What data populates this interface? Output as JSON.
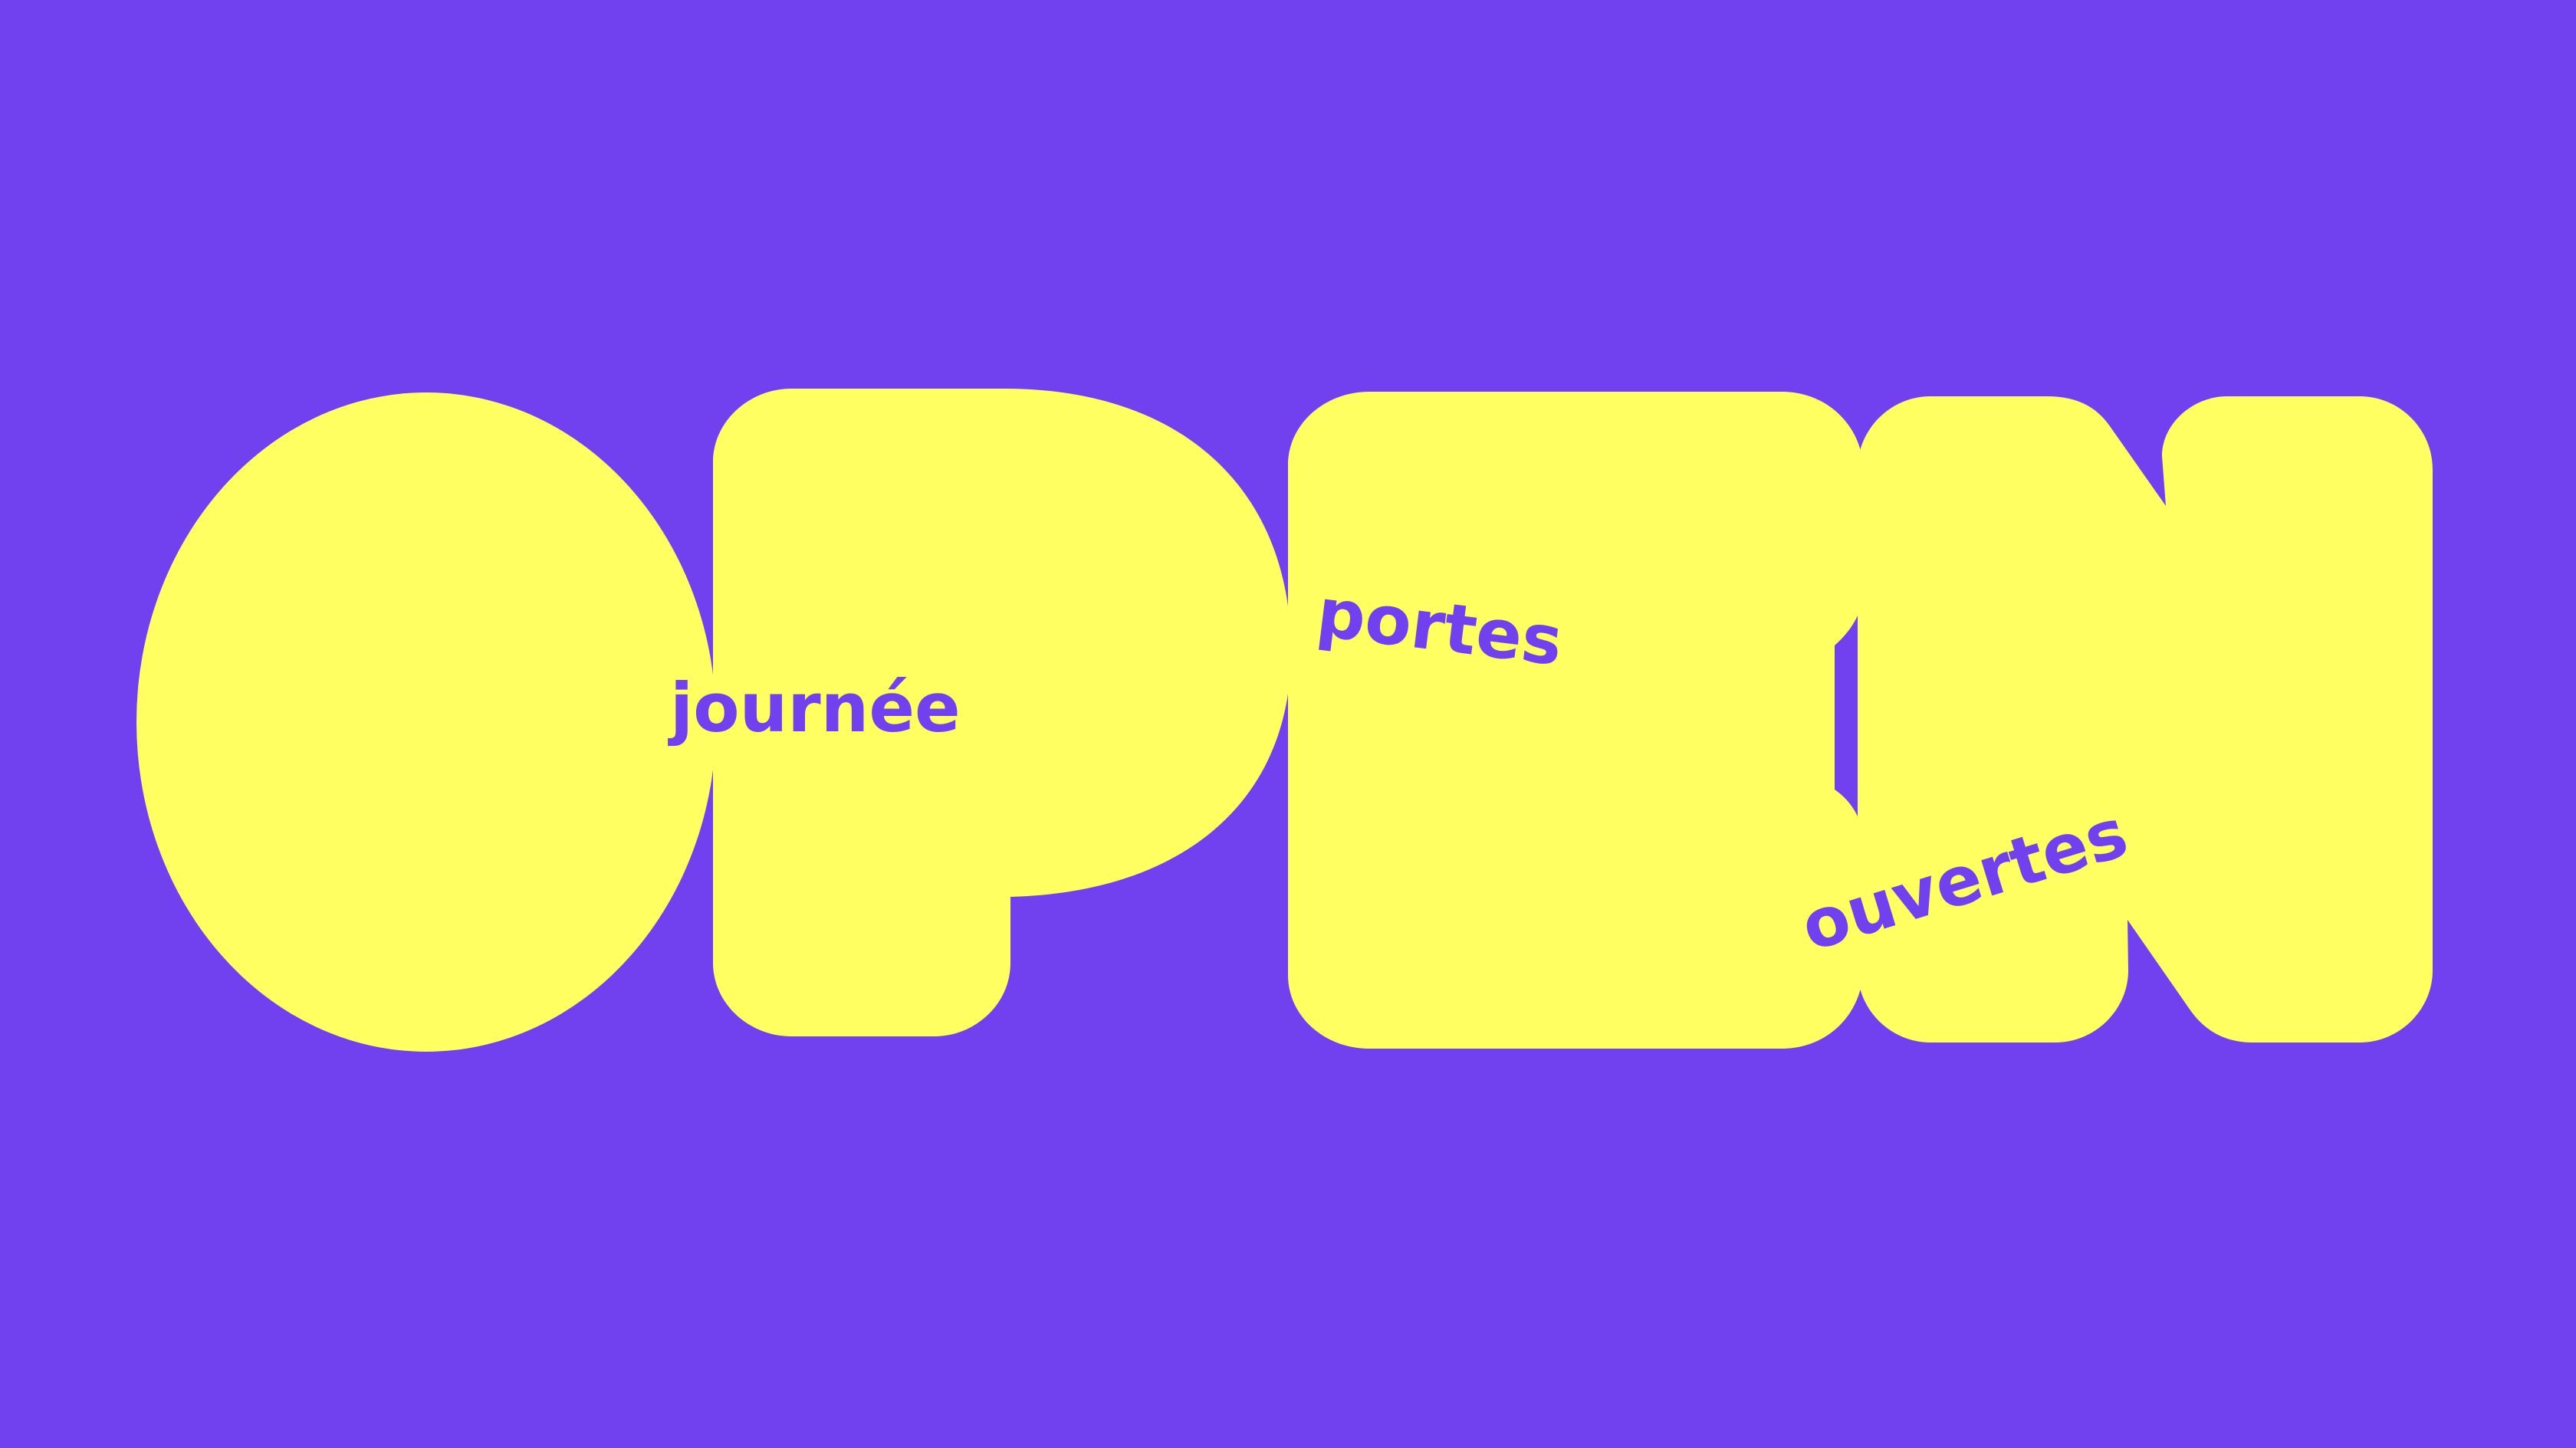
{
  "poster": {
    "big_word": "OPEN",
    "overlay_words": [
      "journée",
      "portes",
      "ouvertes"
    ]
  },
  "colors": {
    "background": "#7140EF",
    "letters": "#FFFF62",
    "overlay_text": "#7140EF"
  }
}
